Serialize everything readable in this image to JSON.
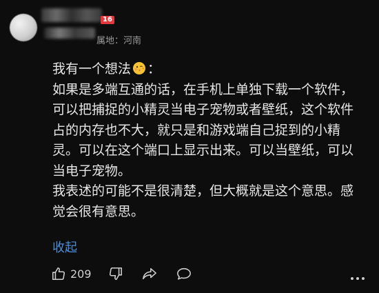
{
  "comment": {
    "user": {
      "level_badge": "16",
      "location": "属地：河南"
    },
    "body": {
      "line1_prefix": "我有一个想法",
      "line1_suffix": "：",
      "emoji": "kiss-face-emoji",
      "lines": [
        "如果是多端互通的话，在手机上单独下载一个软件，",
        "可以把捕捉的小精灵当电子宠物或者壁纸，这个软件",
        "占的内存也不大，就只是和游戏端自己捉到的小精",
        "灵。可以在这个端口上显示出来。可以当壁纸，可以",
        "当电子宠物。",
        "我表述的可能不是很清楚，但大概就是这个意思。感",
        "觉会很有意思。"
      ]
    },
    "collapse_label": "收起",
    "actions": {
      "like_count": "209",
      "like_icon": "thumbs-up-icon",
      "dislike_icon": "thumbs-down-icon",
      "share_icon": "share-icon",
      "reply_icon": "comment-bubble-icon",
      "more_icon": "more-dots-icon"
    }
  },
  "colors": {
    "background": "#0d0d0d",
    "text": "#e6e6e6",
    "link": "#4d8fd6",
    "badge": "#e0393e",
    "muted": "#9a9a9a"
  }
}
